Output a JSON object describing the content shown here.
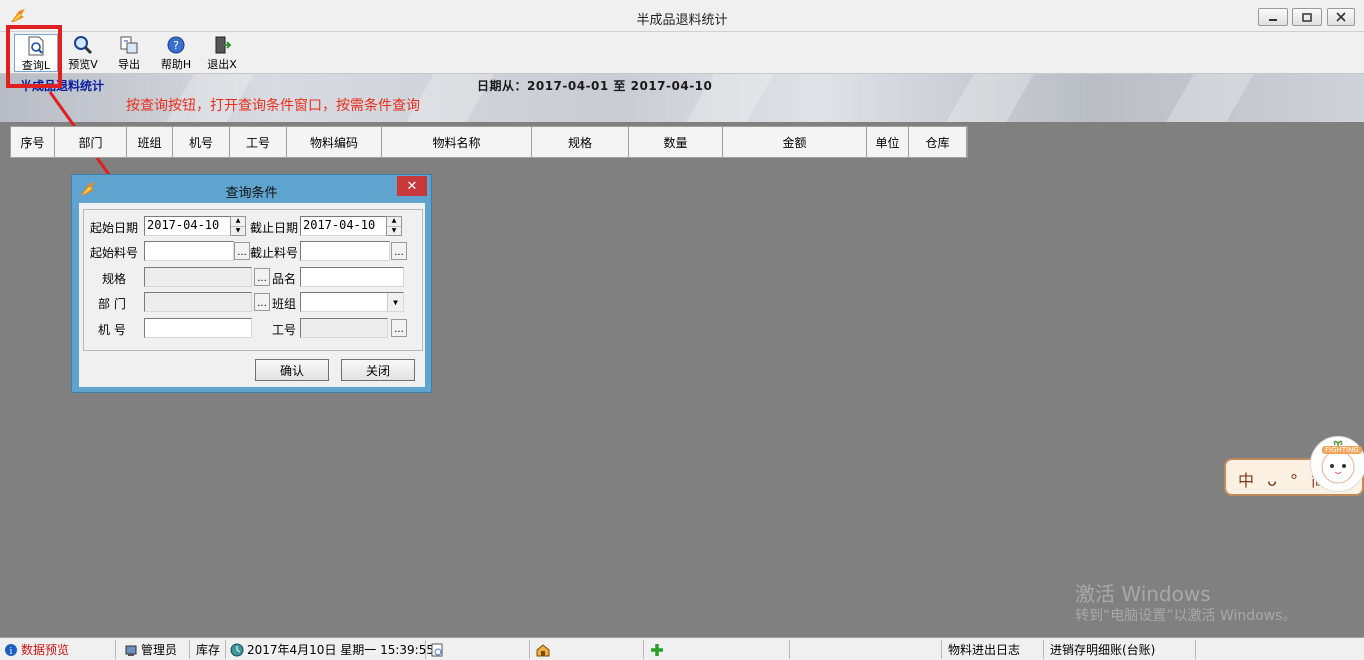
{
  "window": {
    "title": "半成品退料统计"
  },
  "toolbar": {
    "query_label": "查询L",
    "preview_label": "预览V",
    "export_label": "导出",
    "help_label": "帮助H",
    "exit_label": "退出X"
  },
  "report": {
    "name": "半成品退料统计",
    "date_range": "日期从：2017-04-01 至 2017-04-10",
    "annotation": "按查询按钮，打开查询条件窗口，按需条件查询"
  },
  "grid": {
    "columns": [
      "序号",
      "部门",
      "班组",
      "机号",
      "工号",
      "物料编码",
      "物料名称",
      "规格",
      "数量",
      "金额",
      "单位",
      "仓库"
    ]
  },
  "dialog": {
    "title": "查询条件",
    "close": "✕",
    "start_date_label": "起始日期",
    "start_date_value": "2017-04-10",
    "end_date_label": "截止日期",
    "end_date_value": "2017-04-10",
    "start_item_label": "起始料号",
    "end_item_label": "截止料号",
    "spec_label": "规格",
    "name_label": "品名",
    "dept_label": "部  门",
    "team_label": "班组",
    "machine_label": "机  号",
    "worker_label": "工号",
    "ellipsis": "...",
    "confirm_label": "确认",
    "close_label": "关闭"
  },
  "watermark": {
    "line1": "激活 Windows",
    "line2": "转到“电脑设置”以激活 Windows。"
  },
  "ime": {
    "text": "中 ᴗ ° 简",
    "badge": "FIGHTING"
  },
  "statusbar": {
    "data_preview": "数据预览",
    "user": "管理员",
    "module": "库存",
    "datetime": "2017年4月10日 星期一 15:39:55",
    "log": "物料进出日志",
    "ledger": "进销存明细账(台账)"
  },
  "colors": {
    "annotation": "#e8301e",
    "report_name": "#0a1fa0",
    "dialog_frame": "#5fa4cf",
    "highlight_box": "#e02020"
  }
}
